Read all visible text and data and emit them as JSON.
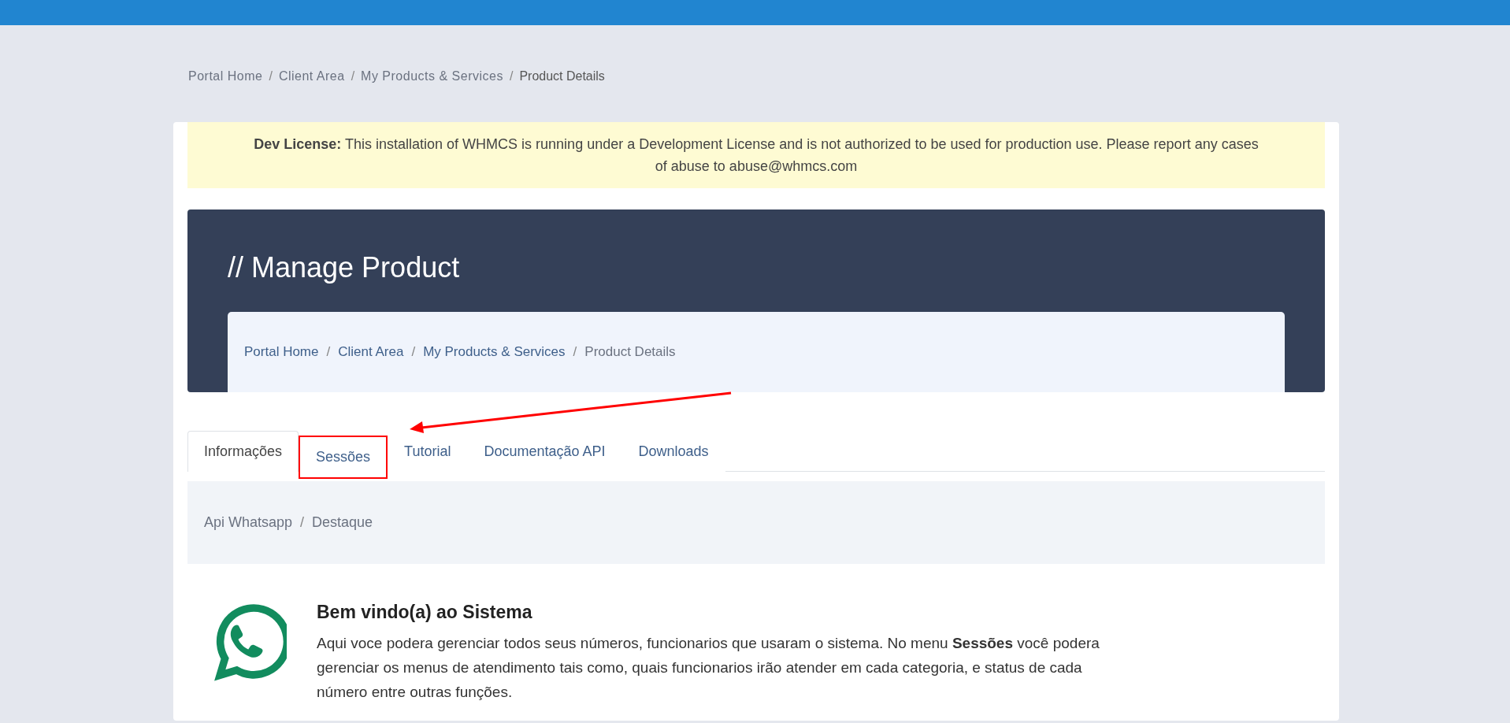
{
  "top_breadcrumb": [
    {
      "label": "Portal Home",
      "current": false
    },
    {
      "separator": "/",
      "label": "Client Area",
      "current": false
    },
    {
      "separator": "/",
      "label": "My Products & Services",
      "current": false
    },
    {
      "separator": "/",
      "label": "Product Details",
      "current": true
    }
  ],
  "alert": {
    "text": "**Dev License:** This installation of WHMCS is running under a Development License and is not authorized to be used for production use. Please report any cases of abuse to abuse@whmcs.com"
  },
  "header": {
    "title": "// Manage Product",
    "breadcrumb": [
      {
        "label": "Portal Home",
        "current": false
      },
      {
        "separator": "/",
        "label": "Client Area",
        "current": false
      },
      {
        "separator": "/",
        "label": "My Products & Services",
        "current": false
      },
      {
        "separator": "/",
        "label": "Product Details",
        "current": true
      }
    ]
  },
  "tabs": [
    {
      "label": "Informações",
      "selected": true,
      "highlighted": false
    },
    {
      "label": "Sessões",
      "selected": false,
      "highlighted": true
    },
    {
      "label": "Tutorial",
      "selected": false,
      "highlighted": false
    },
    {
      "label": "Documentação API",
      "selected": false,
      "highlighted": false
    },
    {
      "label": "Downloads",
      "selected": false,
      "highlighted": false
    }
  ],
  "sub_breadcrumb": [
    {
      "label": "Api Whatsapp"
    },
    {
      "separator": "/",
      "label": "Destaque"
    }
  ],
  "welcome": {
    "title": "Bem vindo(a) ao Sistema",
    "text": "Aqui voce podera gerenciar todos seus números, funcionarios que usaram o sistema. No menu **Sessões** você podera gerenciar os menus de atendimento tais como, quais funcionarios irão atender em cada categoria, e status de cada número entre outras funções."
  }
}
